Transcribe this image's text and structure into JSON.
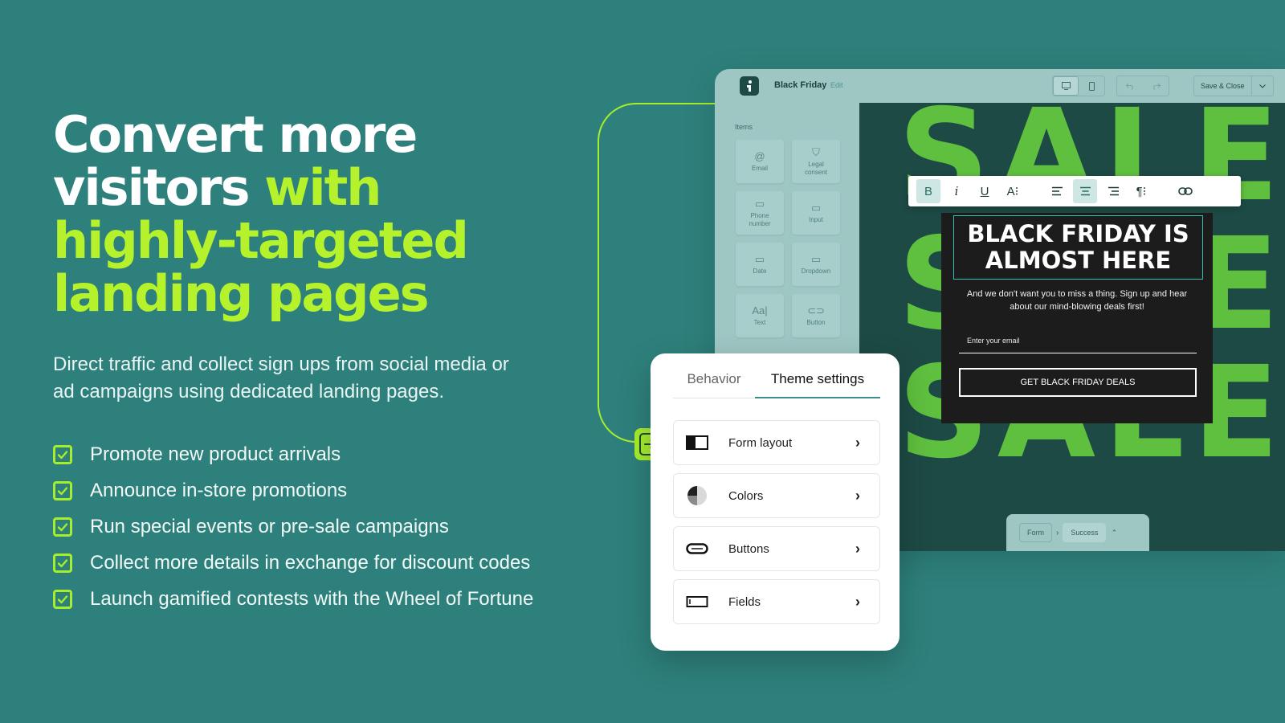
{
  "hero": {
    "headline_white_1": "Convert more",
    "headline_white_2": "visitors",
    "headline_green_1": "with",
    "headline_green_2": "highly-targeted",
    "headline_green_3": "landing pages",
    "subtitle": "Direct traffic and collect sign ups from social media or ad campaigns using dedicated landing pages.",
    "features": [
      "Promote new product arrivals",
      "Announce in-store promotions",
      "Run special events or pre-sale campaigns",
      "Collect more details in exchange for discount codes",
      "Launch gamified contests with the Wheel of Fortune"
    ]
  },
  "editor": {
    "doc_title": "Black Friday",
    "edit_link": "Edit",
    "save_close": "Save & Close",
    "items_label": "Items",
    "items": [
      {
        "icon": "@",
        "label": "Email"
      },
      {
        "icon": "⛉",
        "label": "Legal consent"
      },
      {
        "icon": "▭",
        "label": "Phone number"
      },
      {
        "icon": "▭",
        "label": "Input"
      },
      {
        "icon": "▭",
        "label": "Date"
      },
      {
        "icon": "▭",
        "label": "Dropdown"
      },
      {
        "icon": "Aa|",
        "label": "Text"
      },
      {
        "icon": "⊂⊃",
        "label": "Button"
      }
    ],
    "canvas": {
      "sale_words": [
        "SALE",
        "SALE",
        "SALE"
      ],
      "headline": "BLACK FRIDAY IS ALMOST HERE",
      "body": "And we don't want you to miss a thing. Sign up and hear about our mind-blowing deals first!",
      "input_placeholder": "Enter your email",
      "cta": "GET BLACK FRIDAY DEALS"
    },
    "steps": {
      "form": "Form",
      "success": "Success"
    }
  },
  "toolbar": {
    "bold": "B",
    "italic": "i",
    "underline": "U",
    "font_size": "A⁝",
    "paragraph": "¶⁝"
  },
  "settings": {
    "tabs": {
      "behavior": "Behavior",
      "theme": "Theme settings"
    },
    "cards": [
      {
        "label": "Form layout"
      },
      {
        "label": "Colors"
      },
      {
        "label": "Buttons"
      },
      {
        "label": "Fields"
      }
    ]
  },
  "colors": {
    "background": "#2e807c",
    "accent_green": "#b5f22c",
    "sale_green": "#5fbf3e",
    "canvas_dark": "#1d4a45"
  }
}
